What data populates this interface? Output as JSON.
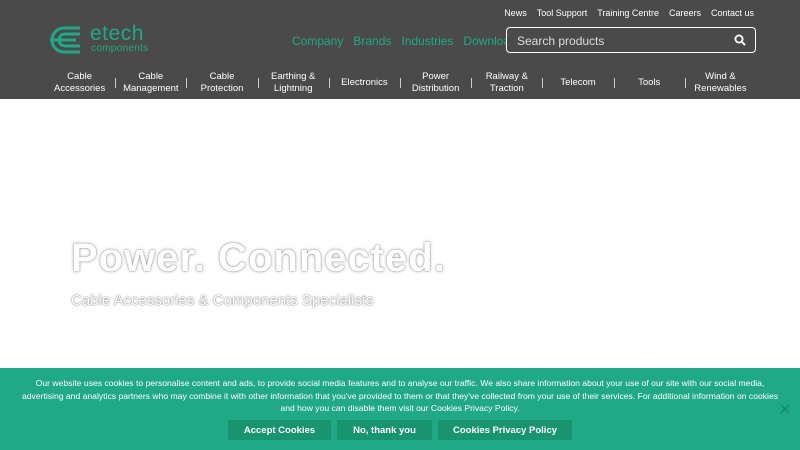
{
  "brand": {
    "name": "etech",
    "tagline": "components",
    "color": "#1fa987"
  },
  "top_links": [
    "News",
    "Tool Support",
    "Training Centre",
    "Careers",
    "Contact us"
  ],
  "main_links": [
    "Company",
    "Brands",
    "Industries",
    "Downloads"
  ],
  "search": {
    "placeholder": "Search products",
    "icon": "search-icon"
  },
  "categories": [
    "Cable\nAccessories",
    "Cable\nManagement",
    "Cable\nProtection",
    "Earthing &\nLightning",
    "Electronics",
    "Power\nDistribution",
    "Railway &\nTraction",
    "Telecom",
    "Tools",
    "Wind &\nRenewables"
  ],
  "hero": {
    "title": "Power. Connected.",
    "subtitle": "Cable Accessories & Components Specialists"
  },
  "cookie_banner": {
    "text": "Our website uses cookies to personalise content and ads, to provide social media features and to analyse our traffic. We also share information about your use of our site with our social media, advertising and analytics partners who may combine it with other information that you've provided to them or that they've collected from your use of their services. For additional information on cookies and how you can disable them visit our Cookies Privacy Policy.",
    "accept_label": "Accept Cookies",
    "decline_label": "No, thank you",
    "policy_label": "Cookies Privacy Policy",
    "close_icon": "close-icon",
    "background": "#1fa987"
  },
  "colors": {
    "header_bg": "#4a4a4a",
    "accent": "#1fa987",
    "button_bg": "#18946f"
  }
}
